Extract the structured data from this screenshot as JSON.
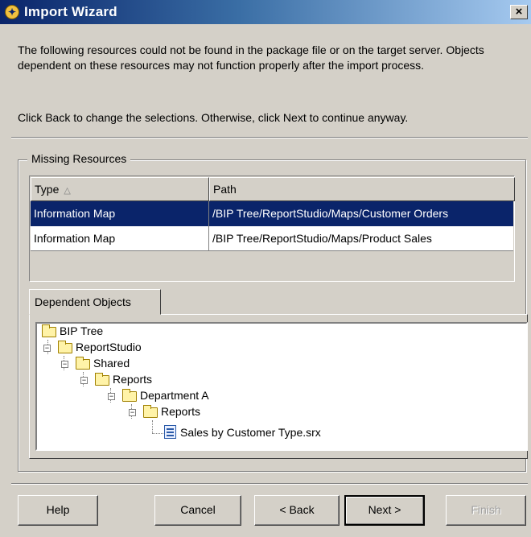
{
  "window": {
    "title": "Import Wizard",
    "close_glyph": "×",
    "title_icon": "wizard-icon"
  },
  "message": {
    "paragraph1": "The following resources could not be found in the package file or on the target server. Objects dependent on these resources may not function properly after the import process.",
    "paragraph2": "Click Back to change the selections.  Otherwise, click Next to continue anyway."
  },
  "missing_resources": {
    "group_label": "Missing Resources",
    "columns": [
      "Type",
      "Path"
    ],
    "sort_indicator": "△",
    "rows": [
      {
        "type": "Information Map",
        "path": "/BIP Tree/ReportStudio/Maps/Customer Orders",
        "selected": true
      },
      {
        "type": "Information Map",
        "path": "/BIP Tree/ReportStudio/Maps/Product Sales",
        "selected": false
      }
    ]
  },
  "dependent_objects": {
    "tab_label": "Dependent Objects",
    "tree": [
      {
        "label": "BIP Tree",
        "icon": "folder-icon",
        "level": 0
      },
      {
        "label": "ReportStudio",
        "icon": "folder-icon",
        "level": 1
      },
      {
        "label": "Shared",
        "icon": "folder-icon",
        "level": 2
      },
      {
        "label": "Reports",
        "icon": "folder-icon",
        "level": 3
      },
      {
        "label": "Department A",
        "icon": "folder-icon",
        "level": 4
      },
      {
        "label": "Reports",
        "icon": "folder-icon",
        "level": 5
      },
      {
        "label": "Sales by Customer Type.srx",
        "icon": "report-file-icon",
        "level": 6
      }
    ]
  },
  "buttons": {
    "help": "Help",
    "cancel": "Cancel",
    "back": "< Back",
    "next": "Next >",
    "finish": "Finish"
  },
  "colors": {
    "selection": "#0a246a",
    "window_bg": "#d4d0c8",
    "title_gradient_start": "#0a246a",
    "title_gradient_end": "#a6caf0"
  }
}
